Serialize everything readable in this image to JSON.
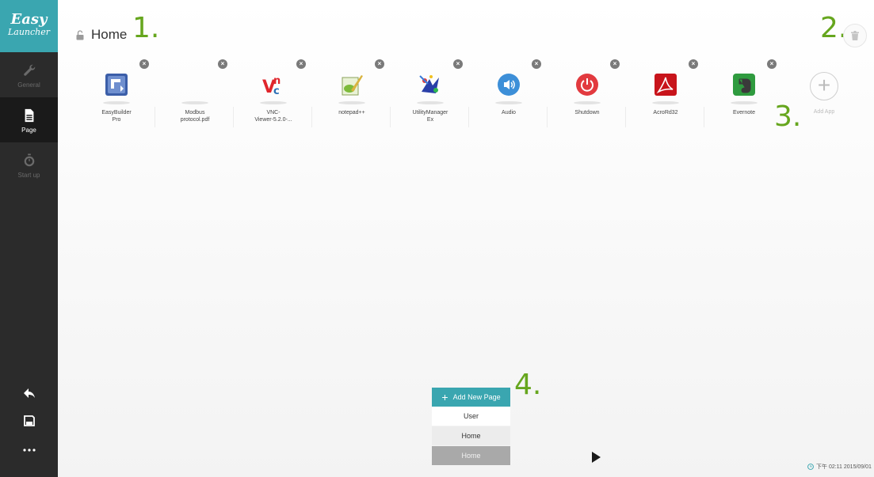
{
  "logo": {
    "line1": "Easy",
    "line2": "Launcher"
  },
  "nav": [
    {
      "label": "General",
      "icon": "wrench-icon"
    },
    {
      "label": "Page",
      "icon": "page-icon",
      "active": true
    },
    {
      "label": "Start up",
      "icon": "stopwatch-icon"
    }
  ],
  "sidebar_actions": [
    "back-arrow-icon",
    "save-icon",
    "more-icon"
  ],
  "header": {
    "title": "Home"
  },
  "annotations": [
    "1.",
    "2.",
    "3.",
    "4."
  ],
  "apps": [
    {
      "name": "EasyBuilder\nPro",
      "icon": "easybuilder-icon"
    },
    {
      "name": "Modbus\nprotocol.pdf",
      "icon": "none"
    },
    {
      "name": "VNC-\nViewer-5.2.0-...",
      "icon": "vnc-icon"
    },
    {
      "name": "notepad++",
      "icon": "notepad-icon"
    },
    {
      "name": "UtilityManager\nEx",
      "icon": "utilitymanager-icon"
    },
    {
      "name": "Audio",
      "icon": "audio-icon"
    },
    {
      "name": "Shutdown",
      "icon": "shutdown-icon"
    },
    {
      "name": "AcroRd32",
      "icon": "acrobat-icon"
    },
    {
      "name": "Evernote",
      "icon": "evernote-icon"
    }
  ],
  "add_app": {
    "label": "Add App"
  },
  "pages": {
    "add_label": "Add New Page",
    "options": [
      "User",
      "Home"
    ],
    "current": "Home"
  },
  "status": {
    "clock": "下午 02:11 2015/09/01"
  },
  "colors": {
    "accent": "#3aa6b0",
    "annotation": "#66a61e",
    "sidebar": "#2b2b2b"
  }
}
